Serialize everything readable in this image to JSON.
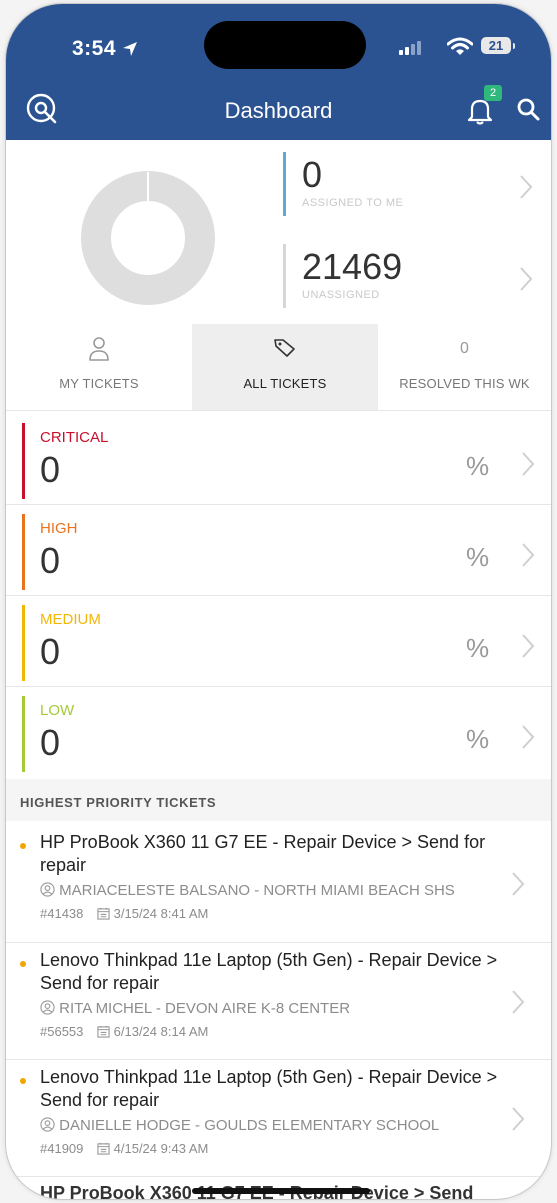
{
  "status_bar": {
    "time": "3:54",
    "battery": "21"
  },
  "header": {
    "title": "Dashboard",
    "notification_count": "2"
  },
  "summary": {
    "assigned_to_me": {
      "count": "0",
      "label": "ASSIGNED TO ME",
      "color": "#5ea9d8"
    },
    "unassigned": {
      "count": "21469",
      "label": "UNASSIGNED",
      "color": "#cfcfcf"
    },
    "donut_color": "#dedede"
  },
  "tabs": [
    {
      "label": "MY TICKETS",
      "icon": "person-icon"
    },
    {
      "label": "ALL TICKETS",
      "icon": "tag-icon",
      "active": true
    },
    {
      "label": "RESOLVED THIS WK",
      "count": "0"
    }
  ],
  "priorities": [
    {
      "name": "CRITICAL",
      "count": "0",
      "percent": "%",
      "color": "#c8102e"
    },
    {
      "name": "HIGH",
      "count": "0",
      "percent": "%",
      "color": "#e8731f"
    },
    {
      "name": "MEDIUM",
      "count": "0",
      "percent": "%",
      "color": "#f2b705"
    },
    {
      "name": "LOW",
      "count": "0",
      "percent": "%",
      "color": "#a6c93a"
    }
  ],
  "section_title": "HIGHEST PRIORITY TICKETS",
  "tickets": [
    {
      "title": "HP ProBook X360 11 G7 EE - Repair Device > Send for repair",
      "requester": "MARIACELESTE BALSANO - NORTH MIAMI BEACH SHS",
      "number": "41438",
      "date": "3/15/24 8:41 AM"
    },
    {
      "title": "Lenovo Thinkpad 11e Laptop (5th Gen) - Repair Device > Send for repair",
      "requester": "RITA MICHEL - DEVON AIRE K-8 CENTER",
      "number": "56553",
      "date": "6/13/24 8:14 AM"
    },
    {
      "title": "Lenovo Thinkpad 11e Laptop (5th Gen) - Repair Device > Send for repair",
      "requester": "DANIELLE HODGE - GOULDS ELEMENTARY SCHOOL",
      "number": "41909",
      "date": "4/15/24 9:43 AM"
    },
    {
      "title": "HP ProBook X360 11 G7 EE - Repair Device > Send"
    }
  ]
}
